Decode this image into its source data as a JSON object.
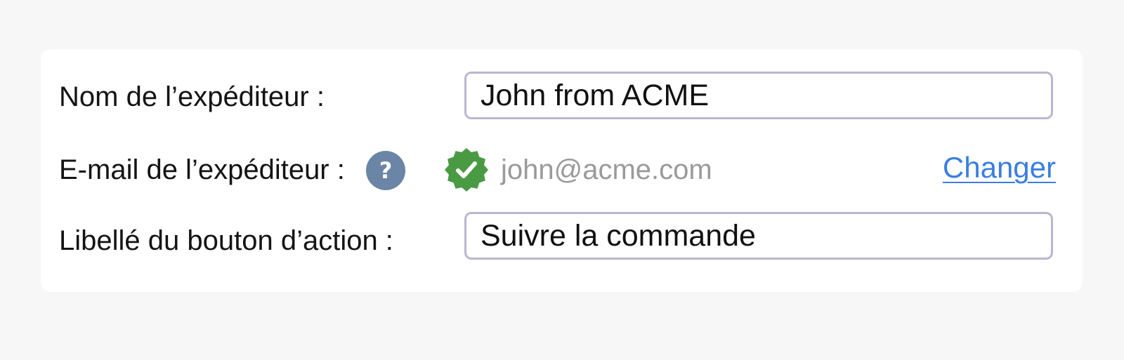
{
  "sender_name": {
    "label": "Nom de l’expéditeur :",
    "value": "John from ACME"
  },
  "sender_email": {
    "label": "E-mail de l’expéditeur :",
    "help_icon": "question-mark-icon",
    "help_glyph": "?",
    "verified_icon": "verified-badge-icon",
    "verified_color": "#4a9a44",
    "value": "john@acme.com",
    "change_link": "Changer",
    "link_color": "#3a7ee0"
  },
  "action_button_label": {
    "label": "Libellé du bouton d’action :",
    "value": "Suivre la commande"
  }
}
